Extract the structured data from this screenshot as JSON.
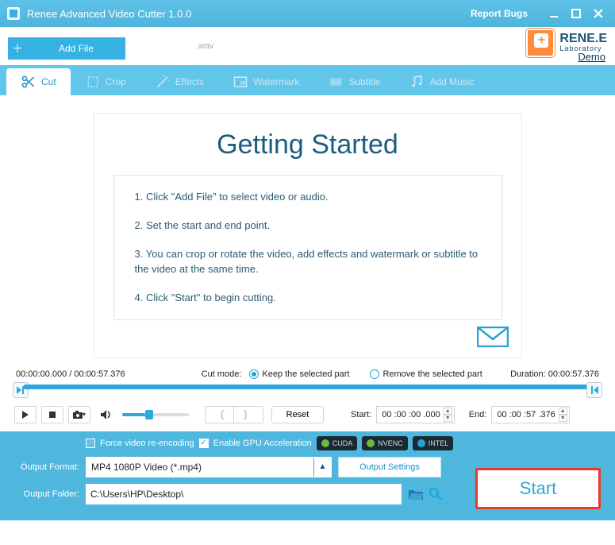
{
  "titlebar": {
    "title": "Renee Advanced Video Cutter 1.0.0",
    "report_bugs": "Report Bugs"
  },
  "toolbar": {
    "add_file": "Add File",
    "filename": ".wav"
  },
  "brand": {
    "name": "RENE.E",
    "sub": "Laboratory",
    "demo": "Demo"
  },
  "tabs": {
    "cut": "Cut",
    "crop": "Crop",
    "effects": "Effects",
    "watermark": "Watermark",
    "subtitle": "Subtitle",
    "add_music": "Add Music"
  },
  "getting_started": {
    "title": "Getting Started",
    "step1": "1. Click \"Add File\" to select video or audio.",
    "step2": "2. Set the start and end point.",
    "step3": "3. You can crop or rotate the video, add effects and watermark or subtitle to the video at the same time.",
    "step4": "4. Click \"Start\" to begin cutting."
  },
  "timeinfo": {
    "position_total": "00:00:00.000 / 00:00:57.376",
    "cut_mode_label": "Cut mode:",
    "keep": "Keep the selected part",
    "remove": "Remove the selected part",
    "duration_label": "Duration:",
    "duration_value": "00:00:57.376"
  },
  "controls": {
    "reset": "Reset",
    "start_label": "Start:",
    "start_value": "00 :00 :00 .000",
    "end_label": "End:",
    "end_value": "00 :00 :57 .376"
  },
  "footer": {
    "force_reencode": "Force video re-encoding",
    "gpu_accel": "Enable GPU Acceleration",
    "cuda": "CUDA",
    "nvenc": "NVENC",
    "intel": "INTEL",
    "out_format_label": "Output Format:",
    "out_format_value": "MP4 1080P Video (*.mp4)",
    "out_settings": "Output Settings",
    "out_folder_label": "Output Folder:",
    "out_folder_value": "C:\\Users\\HP\\Desktop\\",
    "start": "Start"
  }
}
